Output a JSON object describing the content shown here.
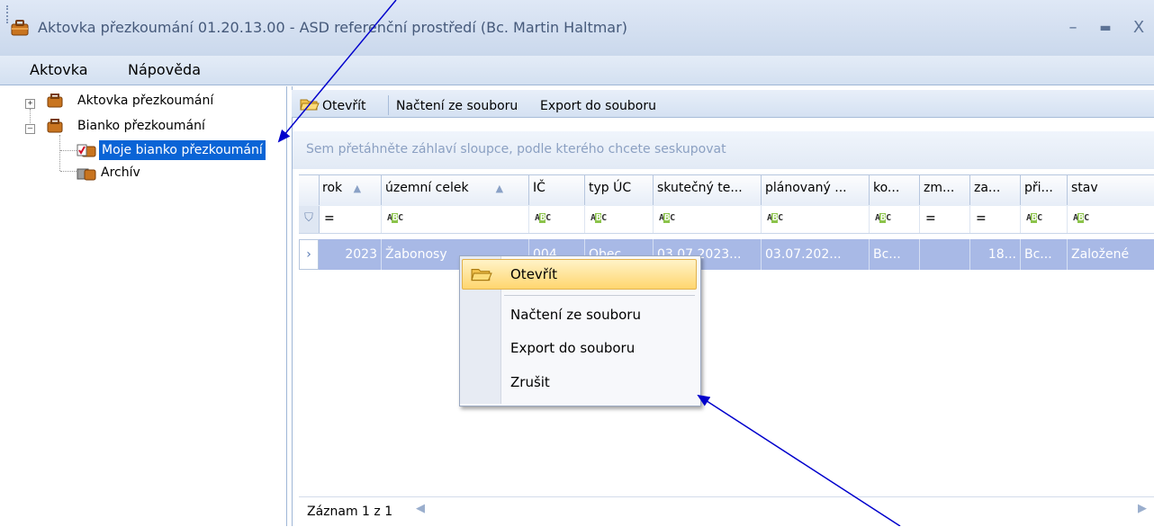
{
  "window": {
    "title": "Aktovka přezkoumání 01.20.13.00 - ASD referenční prostředí (Bc. Martin Haltmar)",
    "controls": [
      "–",
      "▬",
      "X"
    ]
  },
  "menu": {
    "items": [
      "Aktovka",
      "Nápověda"
    ]
  },
  "tree": {
    "items": [
      {
        "label": "Aktovka přezkoumání",
        "expander": "+"
      },
      {
        "label": "Bianko přezkoumání",
        "expander": "–"
      },
      {
        "label": "Moje bianko přezkoumání",
        "selected": true
      },
      {
        "label": "Archív"
      }
    ]
  },
  "toolbar": {
    "open": "Otevřít",
    "load": "Načtení ze souboru",
    "export": "Export do souboru"
  },
  "grid": {
    "group_hint": "Sem přetáhněte záhlaví sloupce, podle kterého chcete seskupovat",
    "columns": [
      "rok",
      "územní celek",
      "IČ",
      "typ ÚC",
      "skutečný te...",
      "plánovaný ...",
      "ko...",
      "zm...",
      "za...",
      "při...",
      "stav"
    ],
    "filter": [
      "=",
      "ABC",
      "ABC",
      "ABC",
      "ABC",
      "ABC",
      "ABC",
      "=",
      "=",
      "ABC",
      "ABC"
    ],
    "rows": [
      [
        "2023",
        "Žabonosy",
        "004...",
        "Obec",
        "03.07.2023...",
        "03.07.202...",
        "Bc...",
        "",
        "18...",
        "Bc...",
        "Založené"
      ]
    ],
    "footer": "Záznam 1 z 1"
  },
  "context_menu": {
    "items": [
      "Otevřít",
      "Načtení ze souboru",
      "Export do souboru",
      "Zrušit"
    ]
  },
  "colors": {
    "accent": "#0a64d6",
    "selected_row": "#a8b9e6",
    "annotation_arrow": "#0000cc"
  }
}
